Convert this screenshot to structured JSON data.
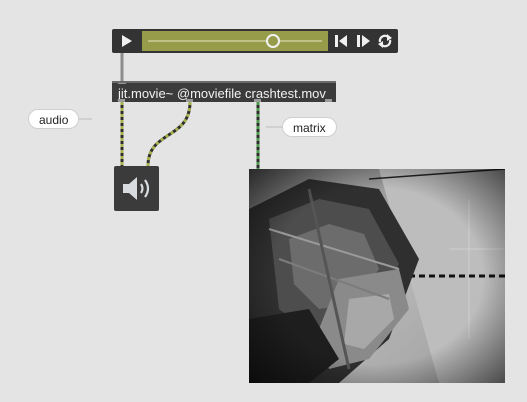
{
  "playbar": {
    "play_icon": "play-icon",
    "step_back_icon": "step-backward-icon",
    "step_forward_icon": "step-forward-icon",
    "loop_icon": "loop-icon",
    "track_color": "#969c4a",
    "background_color": "#333333"
  },
  "jit_movie": {
    "text": "jit.movie~ @moviefile crashtest.mov"
  },
  "comments": {
    "audio": "audio",
    "matrix": "matrix"
  },
  "ezdac": {
    "icon": "speaker-icon"
  },
  "pwindow": {
    "content": "crash-test-video-frame"
  },
  "colors": {
    "patch_background": "#e4e4e4",
    "object_background": "#3b3b3b",
    "audio_cord": "#a8b14a",
    "matrix_cord": "#4a9a4a"
  }
}
